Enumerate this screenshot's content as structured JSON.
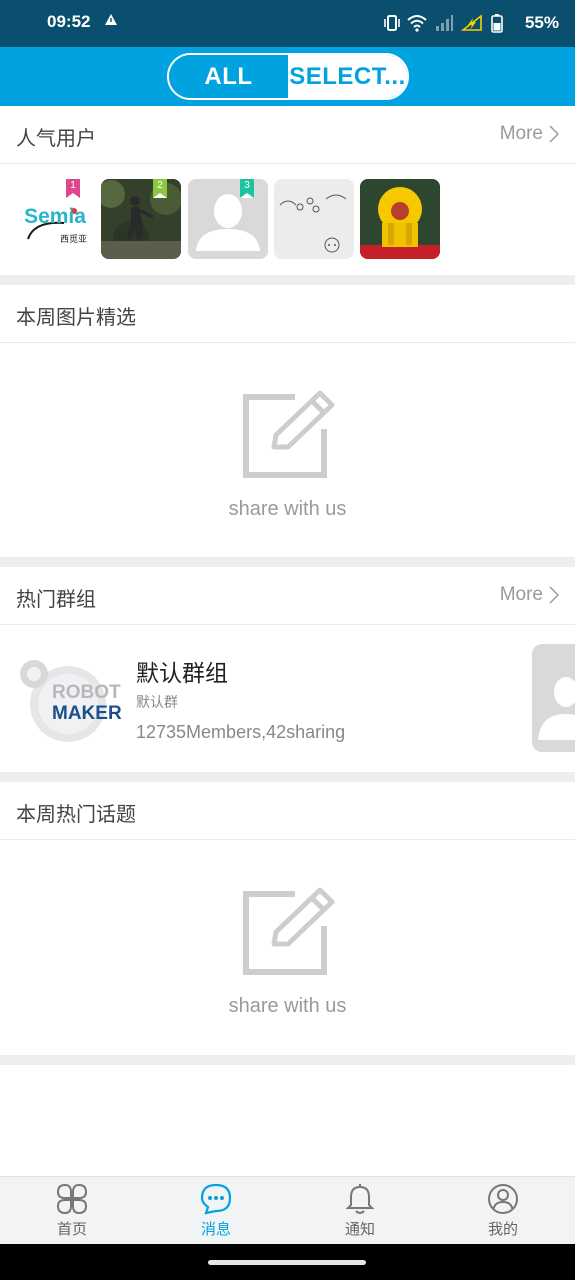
{
  "status_bar": {
    "time": "09:52",
    "battery": "55%"
  },
  "header": {
    "tabs": [
      {
        "label": "ALL",
        "selected": false
      },
      {
        "label": "SELECT...",
        "selected": true
      }
    ]
  },
  "popular_users": {
    "title": "人气用户",
    "more": "More",
    "users": [
      {
        "rank": "1",
        "rank_color": "#e0468f",
        "logo_text": "Semia",
        "logo_sub": "西觅亚"
      },
      {
        "rank": "2",
        "rank_color": "#8cc63f"
      },
      {
        "rank": "3",
        "rank_color": "#1cc3a0"
      },
      {
        "rank": ""
      },
      {
        "rank": ""
      }
    ]
  },
  "weekly_photos": {
    "title": "本周图片精选",
    "empty_text": "share with us"
  },
  "hot_groups": {
    "title": "热门群组",
    "more": "More",
    "group": {
      "logo_line1": "ROBOT",
      "logo_line2": "MAKER",
      "name": "默认群组",
      "sub": "默认群",
      "stats": "12735Members,42sharing"
    }
  },
  "weekly_topics": {
    "title": "本周热门话题",
    "empty_text": "share with us"
  },
  "bottom_nav": {
    "items": [
      {
        "label": "首页",
        "icon": "home-grid-icon"
      },
      {
        "label": "消息",
        "icon": "message-bubble-icon",
        "active": true
      },
      {
        "label": "通知",
        "icon": "bell-icon"
      },
      {
        "label": "我的",
        "icon": "profile-icon"
      }
    ]
  },
  "colors": {
    "accent": "#00a3df",
    "status_bar": "#0a4f6e"
  }
}
